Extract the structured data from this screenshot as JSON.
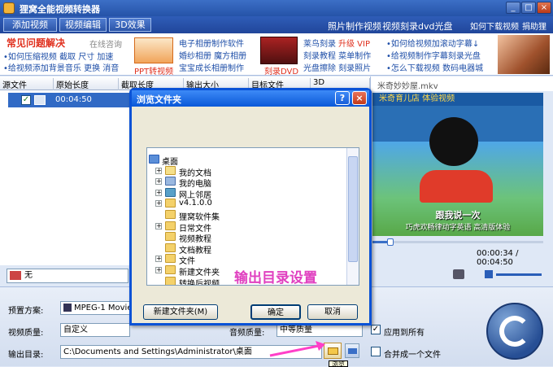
{
  "window": {
    "title": "狸窝全能视频转换器"
  },
  "menu": {
    "left": [
      "添加视频",
      "视频编辑",
      "3D效果"
    ],
    "right": [
      "照片制作视频",
      "视频刻录dvd光盘",
      "如何下载视频",
      "捐助狸窝"
    ]
  },
  "banner": {
    "faq_title": "常见问题解决",
    "online": "在线咨询",
    "faq_lines": [
      "•如何压缩视频 截取 尺寸 加速",
      "•给视频添加背景音乐 更换 消音"
    ],
    "ppt_label": "PPT转视频",
    "links_a": [
      "电子相册制作软件",
      "婚纱相册 魔方相册",
      "宝宝成长相册制作"
    ],
    "dvd_label": "刻录DVD",
    "links_b1": "莱鸟刻录",
    "links_b1_hl": "升级 VIP",
    "links_b": [
      "刻录教程 菜单制作",
      "光盘擦除 刻录照片"
    ],
    "links_c": [
      "•如何给视频加滚动字幕↓",
      "•给视频制作字幕刻录光盘",
      "•怎么下载视频 数码电器城"
    ]
  },
  "table": {
    "headers": [
      "源文件",
      "原始长度",
      "截取长度",
      "输出大小",
      "目标文件",
      "3D"
    ],
    "row": {
      "duration": "00:04:50"
    }
  },
  "preview": {
    "filename": "米奇妙妙屋.mkv",
    "banner_text": "米奇育儿店 体验视频",
    "subtitle1": "跟我说一次",
    "subtitle2": "巧虎欢畅律动字英语 高清版体验",
    "time": "00:00:34 / 00:04:50"
  },
  "subtitle_select": {
    "value": "无"
  },
  "bottom": {
    "preset_label": "预置方案:",
    "preset_value": "MPEG-1 Movie",
    "quality_label": "视频质量:",
    "quality_value": "自定义",
    "audio_label": "音频质量:",
    "audio_value": "中等质量",
    "apply_all": "应用到所有",
    "output_label": "输出目录:",
    "output_value": "C:\\Documents and Settings\\Administrator\\桌面",
    "merge": "合并成一个文件",
    "browse_tip": "浏览"
  },
  "dialog": {
    "title": "浏览文件夹",
    "tree": [
      {
        "label": "桌面",
        "level": 0,
        "icon": "desktop-icon",
        "expander": ""
      },
      {
        "label": "我的文档",
        "level": 1,
        "icon": "documents-icon",
        "expander": "+"
      },
      {
        "label": "我的电脑",
        "level": 1,
        "icon": "computer-icon",
        "expander": "+"
      },
      {
        "label": "网上邻居",
        "level": 1,
        "icon": "network-icon",
        "expander": "+"
      },
      {
        "label": "v4.1.0.0",
        "level": 1,
        "icon": "folder-icon",
        "expander": "+"
      },
      {
        "label": "狸窝软件集",
        "level": 1,
        "icon": "folder-icon",
        "expander": ""
      },
      {
        "label": "日常文件",
        "level": 1,
        "icon": "folder-icon",
        "expander": "+"
      },
      {
        "label": "视频教程",
        "level": 1,
        "icon": "folder-icon",
        "expander": ""
      },
      {
        "label": "文档教程",
        "level": 1,
        "icon": "folder-icon",
        "expander": ""
      },
      {
        "label": "文件",
        "level": 1,
        "icon": "folder-icon",
        "expander": "+"
      },
      {
        "label": "新建文件夹",
        "level": 1,
        "icon": "folder-icon",
        "expander": "+"
      },
      {
        "label": "转换后视频",
        "level": 1,
        "icon": "folder-icon",
        "expander": ""
      }
    ],
    "new_folder": "新建文件夹(M)",
    "ok": "确定",
    "cancel": "取消"
  },
  "overlay_text": "输出目录设置"
}
